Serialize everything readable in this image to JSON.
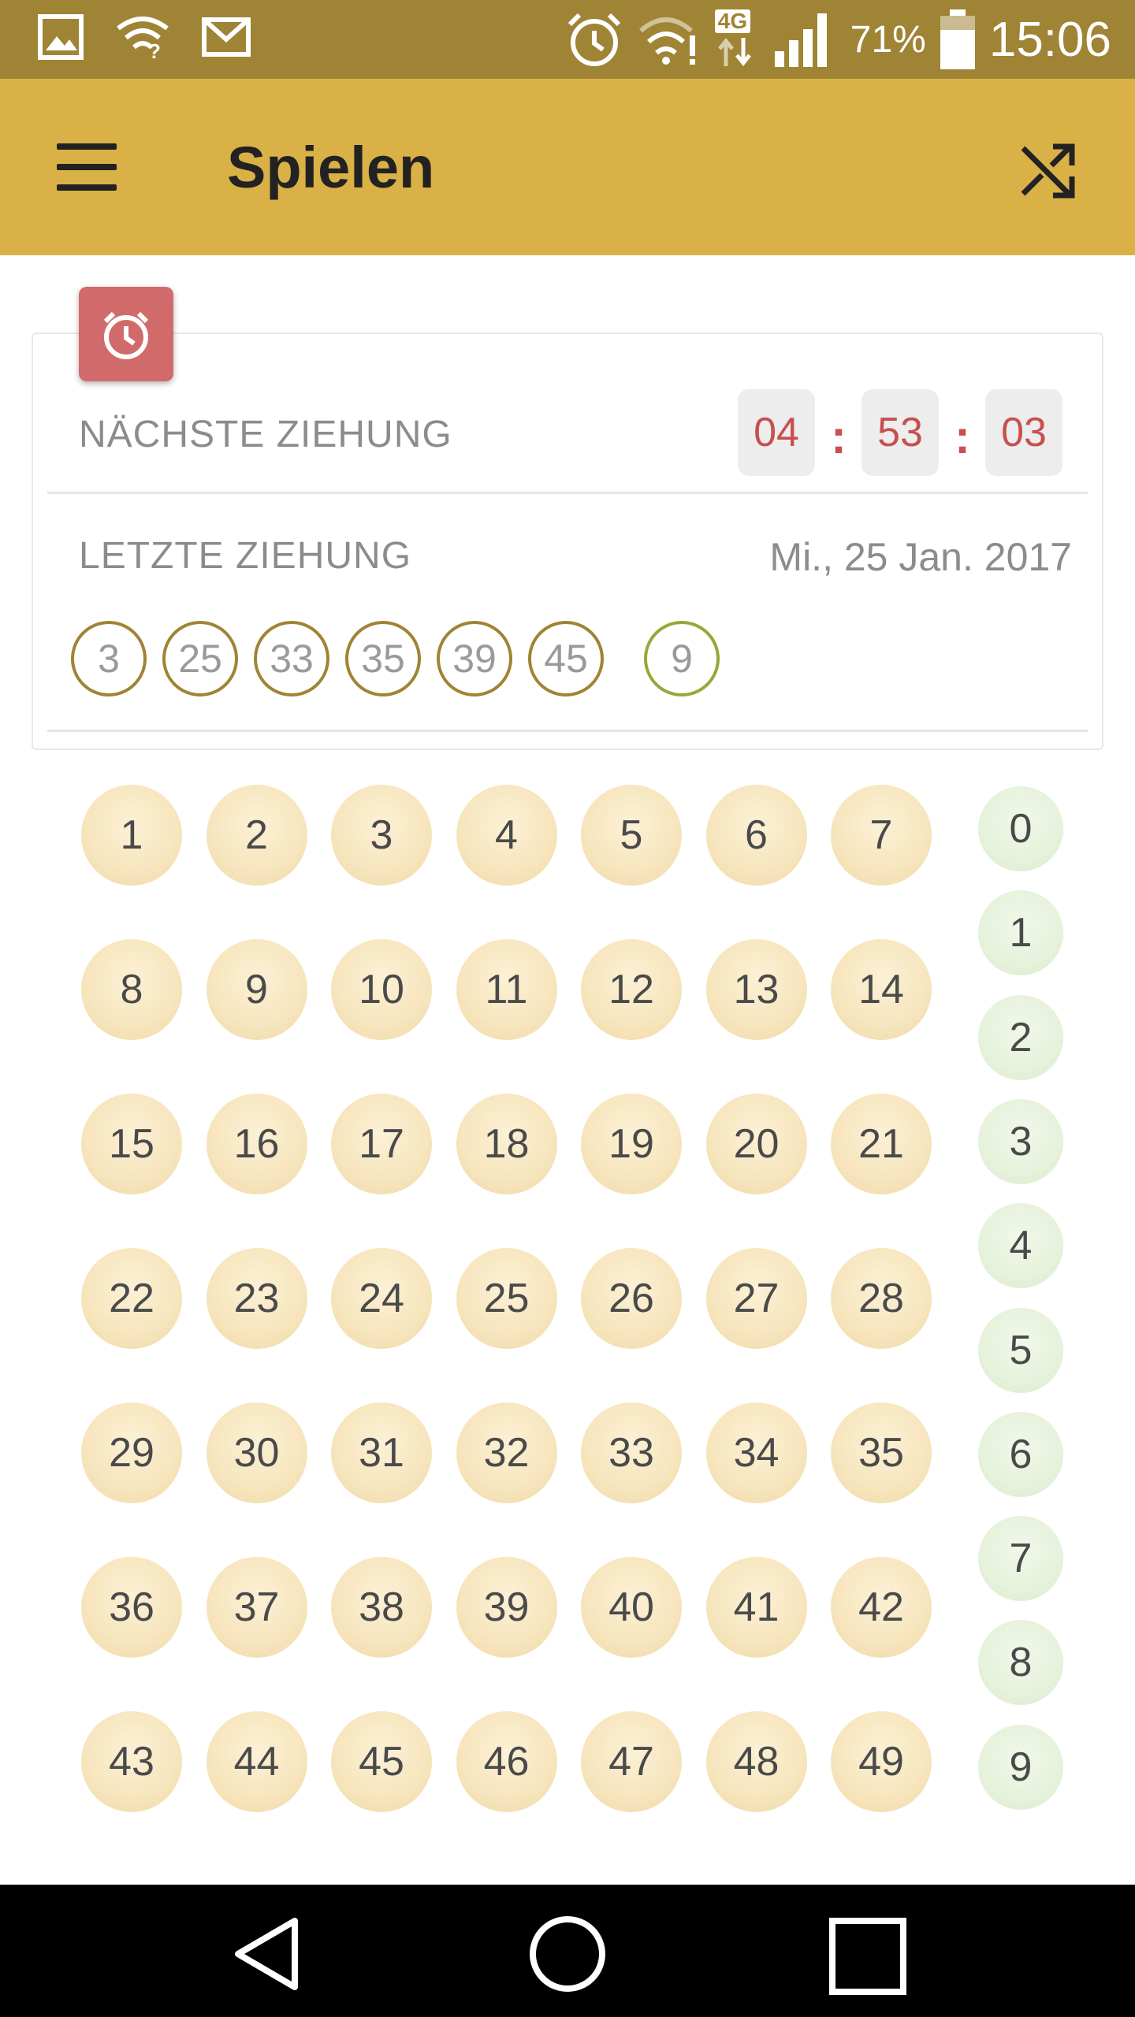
{
  "status_bar": {
    "battery_pct": "71%",
    "time": "15:06",
    "network": "4G",
    "icons": [
      "image-icon",
      "wifi-question-icon",
      "gmail-icon",
      "alarm-icon",
      "wifi-icon",
      "network-4g-icon",
      "signal-icon",
      "battery-icon"
    ]
  },
  "app_bar": {
    "title": "Spielen",
    "menu_icon": "hamburger-menu-icon",
    "action_icon": "shuffle-icon"
  },
  "draw_card": {
    "next_label": "NÄCHSTE ZIEHUNG",
    "countdown": {
      "hours": "04",
      "minutes": "53",
      "seconds": "03",
      "separator": ":"
    },
    "last_label": "LETZTE ZIEHUNG",
    "last_date": "Mi., 25 Jan. 2017",
    "last_numbers": [
      "3",
      "25",
      "33",
      "35",
      "39",
      "45"
    ],
    "last_super": "9"
  },
  "main_numbers": [
    "1",
    "2",
    "3",
    "4",
    "5",
    "6",
    "7",
    "8",
    "9",
    "10",
    "11",
    "12",
    "13",
    "14",
    "15",
    "16",
    "17",
    "18",
    "19",
    "20",
    "21",
    "22",
    "23",
    "24",
    "25",
    "26",
    "27",
    "28",
    "29",
    "30",
    "31",
    "32",
    "33",
    "34",
    "35",
    "36",
    "37",
    "38",
    "39",
    "40",
    "41",
    "42",
    "43",
    "44",
    "45",
    "46",
    "47",
    "48",
    "49"
  ],
  "super_numbers": [
    "0",
    "1",
    "2",
    "3",
    "4",
    "5",
    "6",
    "7",
    "8",
    "9"
  ],
  "colors": {
    "status_bar": "#a08435",
    "app_bar": "#dab146",
    "alarm_badge": "#d16a6a",
    "countdown_text": "#c84f4f",
    "ball": "#f7e6bf",
    "super_ball": "#e6f2db"
  }
}
